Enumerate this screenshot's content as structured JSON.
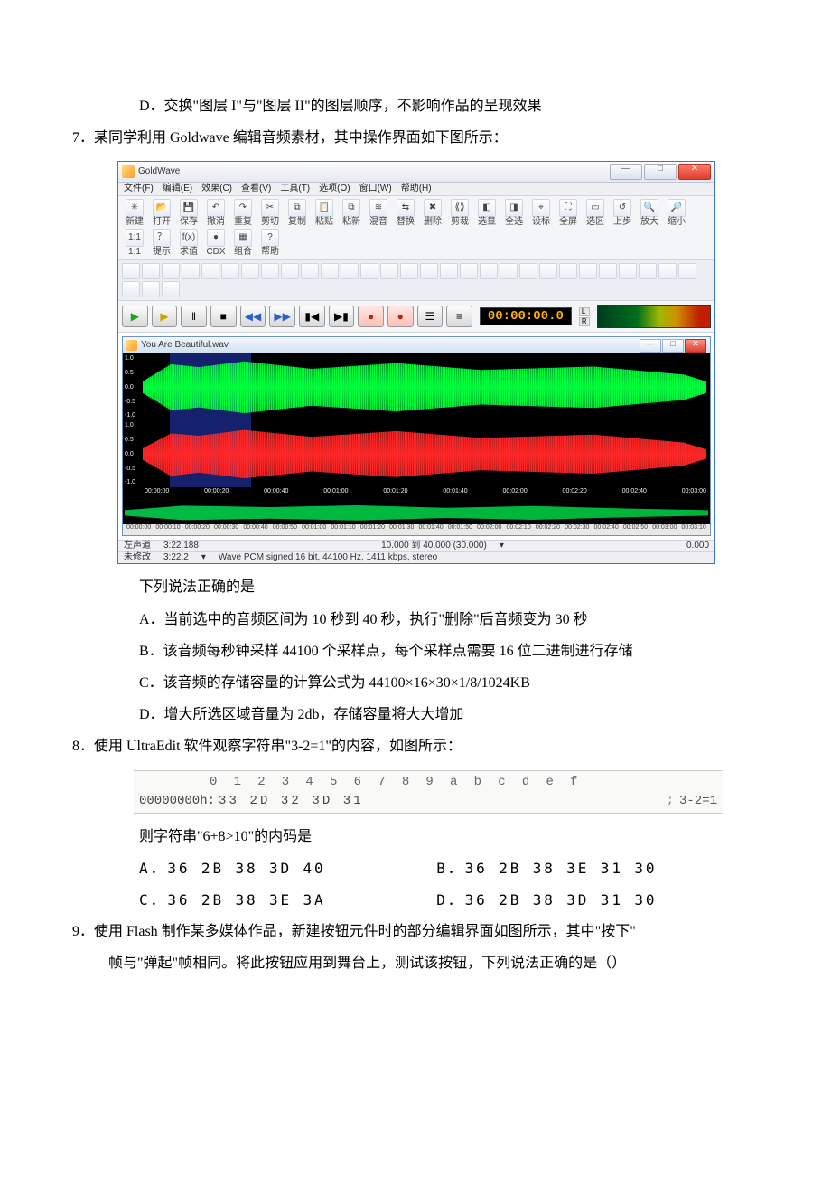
{
  "q6": {
    "d": "D．交换\"图层 I\"与\"图层 II\"的图层顺序，不影响作品的呈现效果"
  },
  "q7": {
    "stem": "7．某同学利用 Goldwave 编辑音频素材，其中操作界面如下图所示：",
    "prompt": "下列说法正确的是",
    "a": "A．当前选中的音频区间为 10 秒到 40 秒，执行\"删除\"后音频变为 30 秒",
    "b": "B．该音频每秒钟采样 44100 个采样点，每个采样点需要 16 位二进制进行存储",
    "c": "C．该音频的存储容量的计算公式为 44100×16×30×1/8/1024KB",
    "d": "D．增大所选区域音量为 2db，存储容量将大大增加"
  },
  "goldwave": {
    "windowTitle": "GoldWave",
    "menus": [
      "文件(F)",
      "编辑(E)",
      "效果(C)",
      "查看(V)",
      "工具(T)",
      "选项(O)",
      "窗口(W)",
      "帮助(H)"
    ],
    "toolbar": [
      "新建",
      "打开",
      "保存",
      "撤消",
      "重复",
      "剪切",
      "复制",
      "粘贴",
      "粘新",
      "混音",
      "替换",
      "删除",
      "剪裁",
      "选显",
      "全选",
      "设标",
      "全屏",
      "选区",
      "上步",
      "放大",
      "缩小",
      "1:1",
      "提示",
      "求值",
      "CDX",
      "组合",
      "帮助"
    ],
    "toolbarIcons": [
      "✳",
      "📂",
      "💾",
      "↶",
      "↷",
      "✂",
      "⧉",
      "📋",
      "⧉",
      "≋",
      "⇆",
      "✖",
      "⟪⟫",
      "◧",
      "◨",
      "⌖",
      "⛶",
      "▭",
      "↺",
      "🔍",
      "🔎",
      "1:1",
      "？",
      "f(x)",
      "●",
      "▦",
      "?"
    ],
    "timecode": "00:00:00.0",
    "lr": [
      "L",
      "R"
    ],
    "docTitle": "You Are Beautiful.wav",
    "yaxis": [
      "1.0",
      "0.5",
      "0.0",
      "-0.5",
      "-1.0"
    ],
    "ruler": [
      "00:00:00",
      "00:00:20",
      "00:00:40",
      "00:01:00",
      "00:01:20",
      "00:01:40",
      "00:02:00",
      "00:02:20",
      "00:02:40",
      "00:03:00"
    ],
    "overviewRuler": [
      "00:00:00",
      "00:00:10",
      "00:00:20",
      "00:00:30",
      "00:00:40",
      "00:00:50",
      "00:01:00",
      "00:01:10",
      "00:01:20",
      "00:01:30",
      "00:01:40",
      "00:01:50",
      "00:02:00",
      "00:02:10",
      "00:02:20",
      "00:02:30",
      "00:02:40",
      "00:02:50",
      "00:03:00",
      "00:03:10"
    ],
    "status": {
      "channel": "左声道",
      "total": "3:22.188",
      "range": "10.000 到 40.000 (30.000)",
      "pos": "0.000",
      "mod": "未修改",
      "total2": "3:22.2",
      "format": "Wave PCM signed 16 bit, 44100 Hz, 1411 kbps, stereo"
    }
  },
  "q8": {
    "stem": "8．使用 UltraEdit 软件观察字符串\"3-2=1\"的内容，如图所示：",
    "rulerDigits": "0 1 2 3 4 5 6 7 8 9 a b c d e f",
    "addr": "00000000h:",
    "hex": "33 2D 32 3D 31",
    "ascii": "3-2=1",
    "sub": "则字符串\"6+8>10\"的内码是",
    "a": "A．36  2B  38  3D  40",
    "b": "B．36  2B  38  3E  31  30",
    "c": "C．36  2B  38  3E  3A",
    "d": "D．36  2B  38  3D  31  30"
  },
  "q9": {
    "stem": "9．使用 Flash 制作某多媒体作品，新建按钮元件时的部分编辑界面如图所示，其中\"按下\"",
    "cont": "帧与\"弹起\"帧相同。将此按钮应用到舞台上，测试该按钮，下列说法正确的是（）"
  }
}
